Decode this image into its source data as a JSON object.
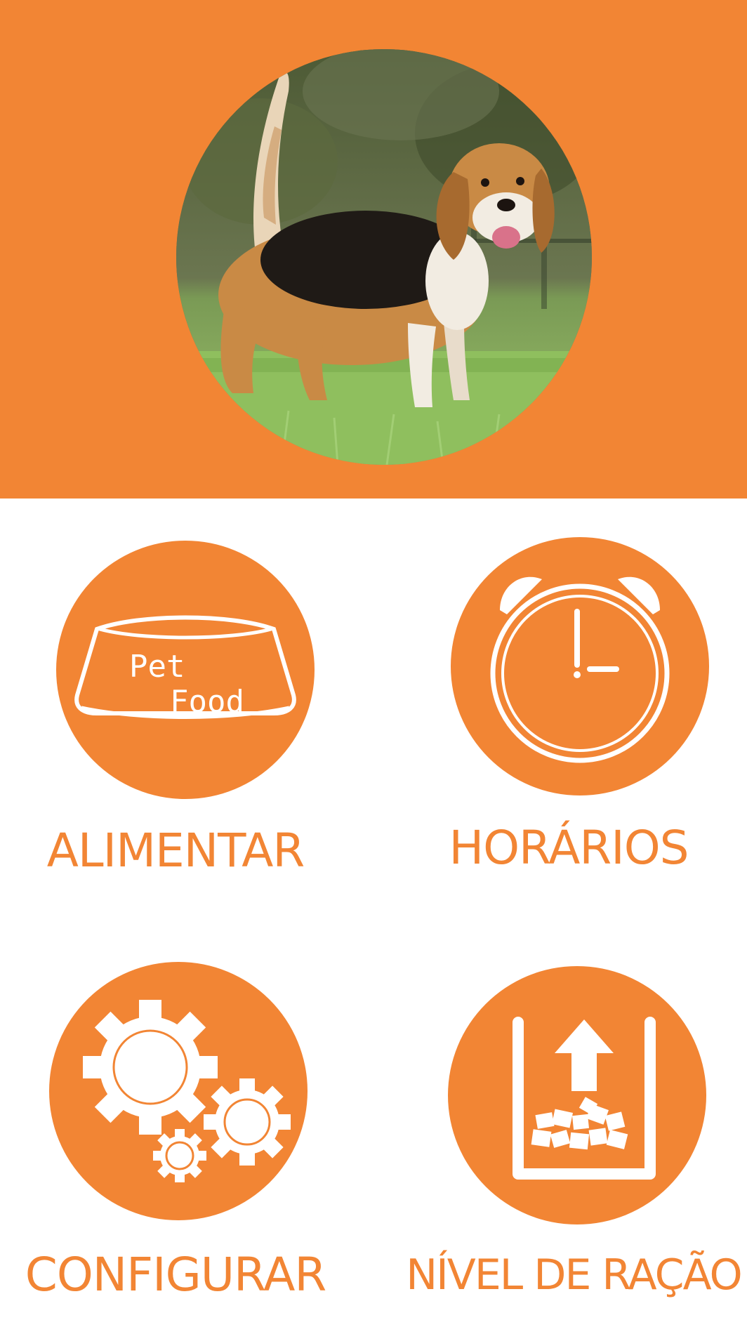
{
  "header": {
    "background_color": "#f28534",
    "photo": "beagle-dog-on-grass-photo"
  },
  "menu": {
    "accent_color": "#f28534",
    "tiles": [
      {
        "id": "alimentar",
        "label": "ALIMENTAR",
        "icon": "pet-food-bowl-icon",
        "icon_text_1": "Pet",
        "icon_text_2": "Food"
      },
      {
        "id": "horarios",
        "label": "HORÁRIOS",
        "icon": "alarm-clock-icon"
      },
      {
        "id": "configurar",
        "label": "CONFIGURAR",
        "icon": "gears-icon"
      },
      {
        "id": "nivel",
        "label": "NÍVEL DE RAÇÃO",
        "icon": "food-level-icon"
      }
    ]
  }
}
